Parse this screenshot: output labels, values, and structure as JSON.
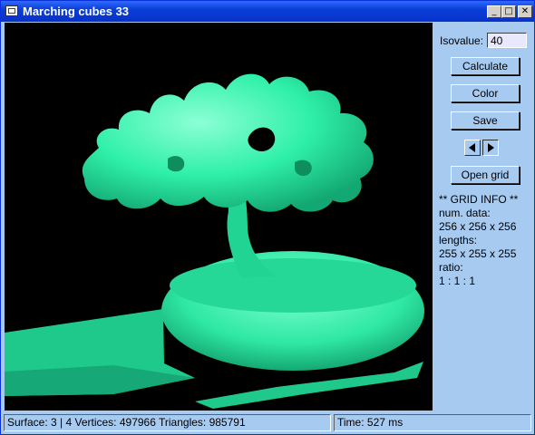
{
  "window": {
    "title": "Marching cubes 33"
  },
  "controls": {
    "isovalue_label": "Isovalue:",
    "isovalue": "40",
    "calculate": "Calculate",
    "color": "Color",
    "save": "Save",
    "open_grid": "Open grid"
  },
  "grid_info": {
    "heading": "** GRID  INFO **",
    "num_data_label": "num. data:",
    "num_data": "256 x 256 x 256",
    "lengths_label": "lengths:",
    "lengths": "255 x 255 x 255",
    "ratio_label": "ratio:",
    "ratio": "1 : 1 : 1"
  },
  "status": {
    "geometry": "Surface: 3 | 4   Vertices: 497966   Triangles: 985791",
    "time": "Time: 527 ms"
  },
  "colors": {
    "surface": "#2FF0A8",
    "background": "#000000",
    "panel": "#A6CAF0"
  },
  "icons": [
    "app-icon",
    "minimize-icon",
    "maximize-icon",
    "close-icon",
    "arrow-left-icon",
    "arrow-right-icon"
  ]
}
